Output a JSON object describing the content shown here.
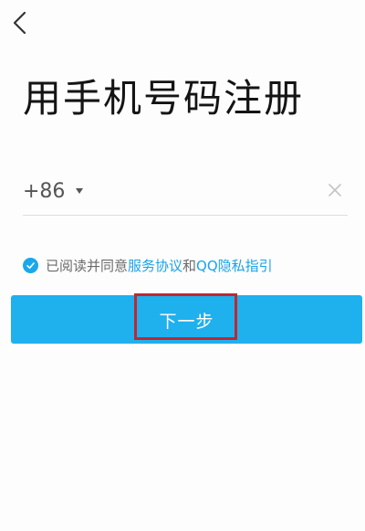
{
  "title": "用手机号码注册",
  "phone": {
    "country_code": "+86",
    "value": "",
    "placeholder": ""
  },
  "agreement": {
    "prefix": "已阅读并同意",
    "service_link": "服务协议",
    "joiner": "和",
    "privacy_link": "QQ隐私指引",
    "checked": true
  },
  "next_button": {
    "label": "下一步"
  },
  "colors": {
    "accent": "#1fb0ee",
    "link": "#1aa3e8",
    "highlight_frame": "#c1272d"
  },
  "icons": {
    "back": "chevron-left-icon",
    "dropdown": "triangle-down-icon",
    "clear": "close-icon",
    "check": "check-icon"
  }
}
